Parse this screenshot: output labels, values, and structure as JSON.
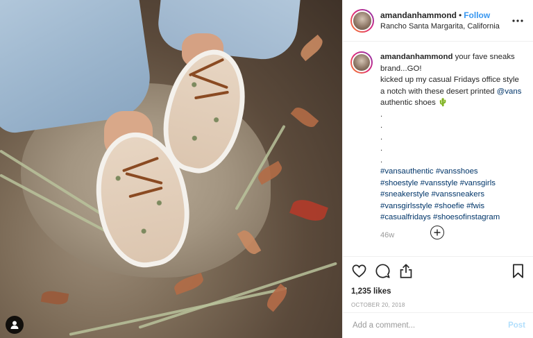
{
  "post": {
    "username": "amandanhammond",
    "dot": "•",
    "follow_label": "Follow",
    "location": "Rancho Santa Margarita, California",
    "more_icon": "more-horizontal-icon"
  },
  "caption": {
    "username": "amandanhammond",
    "text_line1": " your fave sneaks brand...GO!",
    "text_line2_before": "kicked up my casual Fridays office style a notch with these desert printed ",
    "mention": "@vans",
    "text_line2_after": " authentic shoes 🌵",
    "dots": [
      ".",
      ".",
      ".",
      ".",
      "."
    ],
    "hashtags": [
      [
        "#vansauthentic",
        "#vansshoes"
      ],
      [
        "#shoestyle",
        "#vansstyle",
        "#vansgirls"
      ],
      [
        "#sneakerstyle",
        "#vanssneakers"
      ],
      [
        "#vansgirlsstyle",
        "#shoefie",
        "#fwis"
      ],
      [
        "#casualfridays",
        "#shoesofinstagram"
      ]
    ],
    "time_ago": "46w"
  },
  "actions": {
    "likes": "1,235 likes",
    "date": "OCTOBER 20, 2018"
  },
  "comment": {
    "placeholder": "Add a comment...",
    "post_label": "Post"
  },
  "colors": {
    "link": "#3897f0",
    "hashtag": "#003569",
    "post_disabled": "#b2dffc"
  }
}
